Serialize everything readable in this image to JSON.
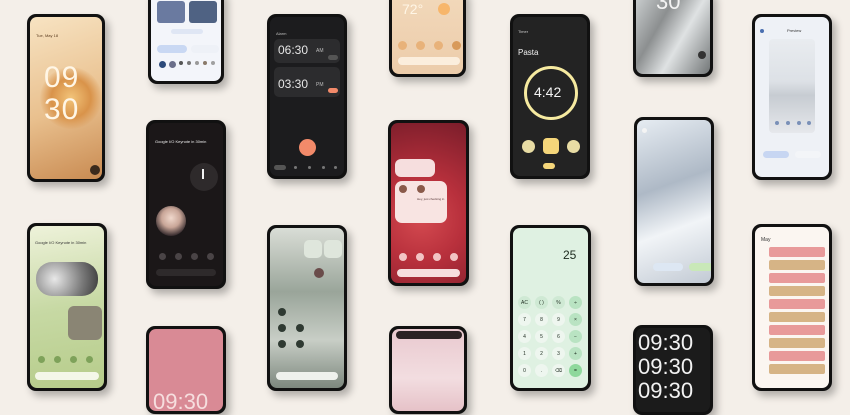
{
  "colors": {
    "background": "#f4efe9",
    "bezel": "#111111",
    "clock_peach": "#f4e3c6",
    "timer_yellow": "#f6eaa0",
    "timer_accent": "#f5d67a",
    "alarm_accent": "#f28a6a",
    "calc_mint": "#dff1e2",
    "calc_green": "#8ed89c",
    "calendar_pink": "#e89a9a",
    "calendar_tan": "#d6b486"
  },
  "clock_phone": {
    "date": "Tue, May 18",
    "hour": "09",
    "minute": "30"
  },
  "weather_phone": {
    "temp": "72°"
  },
  "timer_phone": {
    "header": "Timer",
    "label": "Pasta",
    "time": "4:42"
  },
  "alarm_phone": {
    "header": "Alarm",
    "alarms": [
      {
        "time": "06:30",
        "suffix": "AM"
      },
      {
        "time": "03:30",
        "suffix": "PM"
      }
    ]
  },
  "photo_phone": {
    "top_text": "Google I/O Keynote in 30min"
  },
  "keynote_phone": {
    "top_text": "Google I/O Keynote in 30min"
  },
  "wallpaper_phone": {
    "title": "Preview"
  },
  "conversation_widget": {
    "text": "Hey, just checking in"
  },
  "calc_phone": {
    "display": "25",
    "keys": [
      "AC",
      "( )",
      "%",
      "÷",
      "7",
      "8",
      "9",
      "×",
      "4",
      "5",
      "6",
      "−",
      "1",
      "2",
      "3",
      "+",
      "0",
      ".",
      "⌫",
      "="
    ]
  },
  "calendar_phone": {
    "month": "May"
  },
  "big_clock_phone": {
    "times": [
      "09:30",
      "09:30",
      "09:30"
    ]
  },
  "pink_clock_phone": {
    "time": "09:30"
  },
  "nav": {
    "search_icon": "search-icon",
    "mic_icon": "mic-icon",
    "google_icon": "google-icon"
  }
}
